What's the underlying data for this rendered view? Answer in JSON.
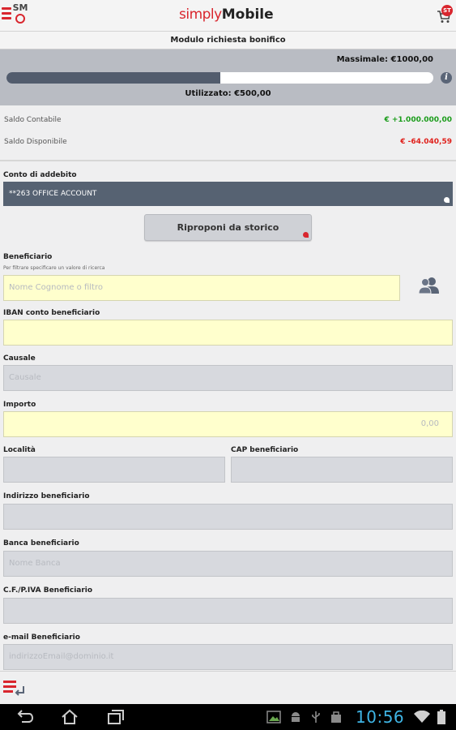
{
  "header": {
    "brand_simply": "simply",
    "brand_mobile": "Mobile",
    "cart_badge": "ST"
  },
  "subtitle": "Modulo richiesta bonifico",
  "plafond": {
    "max_label": "Massimale: €1000,00",
    "used_label": "Utilizzato: €500,00",
    "progress_fraction": 0.5
  },
  "balances": [
    {
      "label": "Saldo Contabile",
      "value": "€ +1.000.000,00",
      "color": "#1a9c1a"
    },
    {
      "label": "Saldo Disponibile",
      "value": "€ -64.040,59",
      "color": "#e0201b"
    }
  ],
  "form": {
    "account_label": "Conto di addebito",
    "account_value": "**263 OFFICE ACCOUNT",
    "history_button": "Riproponi da storico",
    "beneficiary_label": "Beneficiario",
    "beneficiary_hint": "Per filtrare specificare un valore di ricerca",
    "beneficiary_placeholder": "Nome Cognome o filtro",
    "iban_label": "IBAN conto beneficiario",
    "iban_value": "",
    "causale_label": "Causale",
    "causale_placeholder": "Causale",
    "importo_label": "Importo",
    "importo_value": "0,00",
    "localita_label": "Località",
    "localita_value": "",
    "cap_label": "CAP beneficiario",
    "cap_value": "",
    "indirizzo_label": "Indirizzo beneficiario",
    "indirizzo_value": "",
    "banca_label": "Banca beneficiario",
    "banca_placeholder": "Nome Banca",
    "cf_label": "C.F./P.IVA Beneficiario",
    "cf_value": "",
    "email_label": "e-mail Beneficiario",
    "email_placeholder": "indirizzoEmail@dominio.it"
  },
  "statusbar": {
    "clock": "10:56"
  },
  "colors": {
    "accent": "#d9262e",
    "panel": "#b9bcc3",
    "account_bg": "#566272",
    "field_yellow": "#ffffcd",
    "field_gray": "#d7d9de",
    "clock": "#3fb5e5"
  }
}
